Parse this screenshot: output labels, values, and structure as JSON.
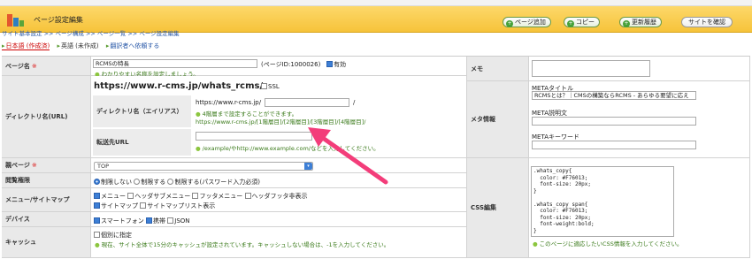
{
  "header": {
    "title": "ページ設定編集",
    "buttons": {
      "add": "ページ追加",
      "copy": "コピー",
      "history": "更新履歴",
      "preview": "サイトを確認"
    }
  },
  "breadcrumb": "サイト基本設定 >> ページ構成 >> ページ一覧 >> ページ設定編集",
  "languages": {
    "ja": "日本語 (作成済)",
    "en": "英語 (未作成)",
    "request": "翻訳者へ依頼する"
  },
  "form": {
    "page_name": {
      "label": "ページ名",
      "required": "※",
      "value": "RCMSの特長",
      "page_id": "(ページID:1000026)",
      "enabled": "有効",
      "hint": "わかりやすい名称を設定しましょう。"
    },
    "directory": {
      "label": "ディレクトリ名(URL)",
      "full_url": "https://www.r-cms.jp/whats_rcms/",
      "ssl": "SSL",
      "alias_label": "ディレクトリ名（エイリアス）",
      "alias_prefix": "https://www.r-cms.jp/",
      "alias_suffix": "/",
      "alias_hint": "4階層まで設定することができます。",
      "alias_example": "https://www.r-cms.jp/[1階層目]/[2階層目]/[3階層目]/[4階層目]/",
      "redirect_label": "転送先URL",
      "redirect_hint": "/example/やhttp://www.example.com/などを入力してください。"
    },
    "parent": {
      "label": "親ページ",
      "required": "※",
      "value": "TOP"
    },
    "access": {
      "label": "閲覧権限",
      "options": [
        "制限しない",
        "制限する",
        "制限する(パスワード入力必須)"
      ]
    },
    "menu": {
      "label": "メニュー/サイトマップ",
      "items": [
        "メニュー",
        "ヘッダサブメニュー",
        "フッタメニュー",
        "ヘッダフッタ非表示",
        "サイトマップ",
        "サイトマップリスト表示"
      ]
    },
    "device": {
      "label": "デバイス",
      "items": [
        "スマートフォン",
        "携帯",
        "JSON"
      ]
    },
    "cache": {
      "label": "キャッシュ",
      "checkbox": "個別に指定",
      "hint": "現在、サイト全体で15分のキャッシュが設定されています。キャッシュしない場合は、-1を入力してください。"
    },
    "memo": {
      "label": "メモ"
    },
    "meta": {
      "label": "メタ情報",
      "title_label": "METAタイトル",
      "title_value": "RCMSとは？｜CMSの構築ならRCMS - あらゆる要望に応え",
      "desc_label": "META説明文",
      "keywords_label": "METAキーワード"
    },
    "css": {
      "label": "CSS編集",
      "code": ".whats_copy{\n  color: #F76013;\n  font-size: 20px;\n}\n\n.whats_copy span{\n  color: #F76013;\n  font-size: 20px;\n  font-weight:bold;\n}",
      "hint": "このページに適応したいCSS情報を入力してください。"
    }
  }
}
